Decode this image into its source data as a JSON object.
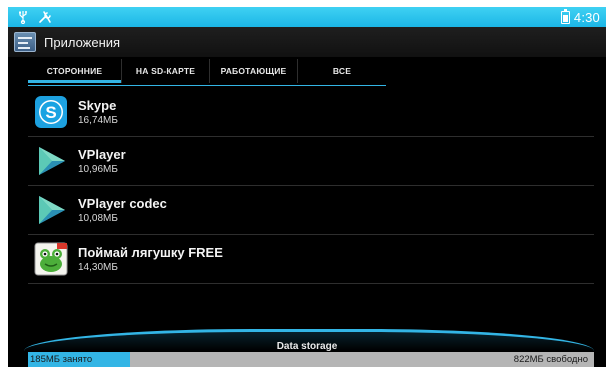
{
  "status_bar": {
    "icons": [
      "usb-icon",
      "tools-icon",
      "battery-icon"
    ],
    "time": "4:30",
    "color": "#33b5e5"
  },
  "action_bar": {
    "title": "Приложения",
    "icon": "app-manager-icon"
  },
  "tabs": [
    {
      "label": "СТОРОННИЕ",
      "active": true
    },
    {
      "label": "НА SD-КАРТЕ",
      "active": false
    },
    {
      "label": "РАБОТАЮЩИЕ",
      "active": false
    },
    {
      "label": "ВСЕ",
      "active": false
    }
  ],
  "apps": [
    {
      "name": "Skype",
      "size": "16,74МБ",
      "icon": "skype-icon"
    },
    {
      "name": "VPlayer",
      "size": "10,96МБ",
      "icon": "vplayer-icon"
    },
    {
      "name": "VPlayer codec",
      "size": "10,08МБ",
      "icon": "vplayer-codec-icon"
    },
    {
      "name": "Поймай лягушку FREE",
      "size": "14,30МБ",
      "icon": "frog-game-icon"
    }
  ],
  "storage": {
    "title": "Data storage",
    "used_label": "185МБ занято",
    "free_label": "822МБ свободно",
    "used_fraction": 0.18
  },
  "colors": {
    "accent": "#33b5e5",
    "background": "#000000",
    "storage_free": "#b5b5b5"
  }
}
